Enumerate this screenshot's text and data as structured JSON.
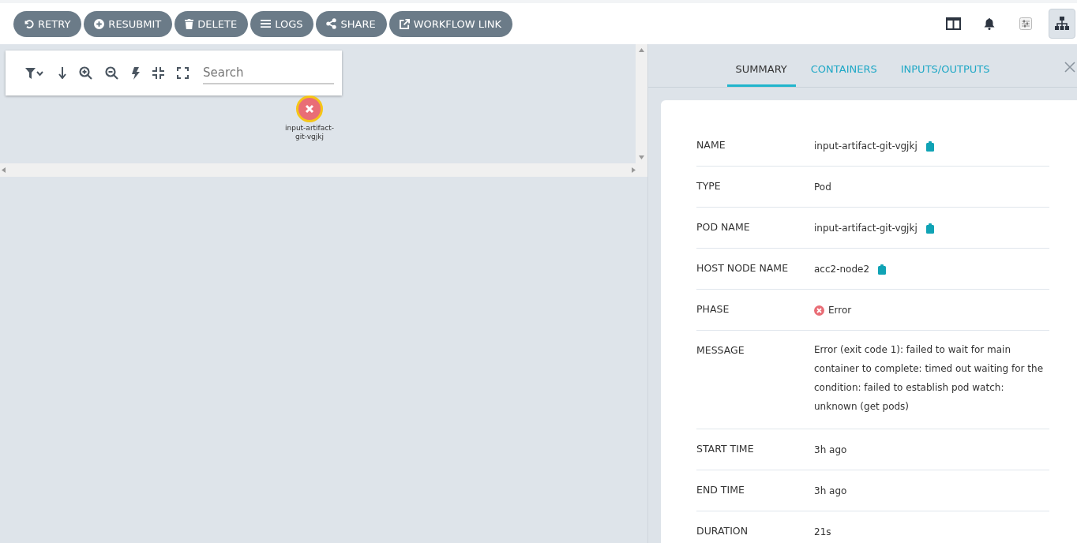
{
  "actions": [
    {
      "label": "RETRY"
    },
    {
      "label": "RESUBMIT"
    },
    {
      "label": "DELETE"
    },
    {
      "label": "LOGS"
    },
    {
      "label": "SHARE"
    },
    {
      "label": "WORKFLOW LINK"
    }
  ],
  "view_buttons": [
    {
      "selected": false
    },
    {
      "selected": false
    },
    {
      "selected": false
    },
    {
      "selected": true
    }
  ],
  "graph": {
    "search": {
      "placeholder": "Search"
    },
    "nodes": [
      {
        "label": "input-artifact-git-vgjkj",
        "failed": true
      }
    ]
  },
  "panel": {
    "tabs": [
      {
        "label": "SUMMARY",
        "selected": true
      },
      {
        "label": "CONTAINERS",
        "selected": false
      },
      {
        "label": "INPUTS/OUTPUTS",
        "selected": false
      }
    ],
    "rows": [
      {
        "label": "NAME",
        "value": "input-artifact-git-vgjkj",
        "kind": "copyable"
      },
      {
        "label": "TYPE",
        "value": "Pod",
        "kind": "plain"
      },
      {
        "label": "POD NAME",
        "value": "input-artifact-git-vgjkj",
        "kind": "copyable"
      },
      {
        "label": "HOST NODE NAME",
        "value": "acc2-node2",
        "kind": "copyable"
      },
      {
        "label": "PHASE",
        "value": "Error",
        "kind": "error"
      },
      {
        "label": "MESSAGE",
        "value": "Error (exit code 1): failed to wait for main container to complete: timed out waiting for the condition: failed to establish pod watch: unknown (get pods)",
        "kind": "plain"
      },
      {
        "label": "START TIME",
        "value": "3h ago",
        "kind": "plain"
      },
      {
        "label": "END TIME",
        "value": "3h ago",
        "kind": "plain"
      },
      {
        "label": "DURATION",
        "value": "21s",
        "kind": "plain"
      }
    ]
  }
}
